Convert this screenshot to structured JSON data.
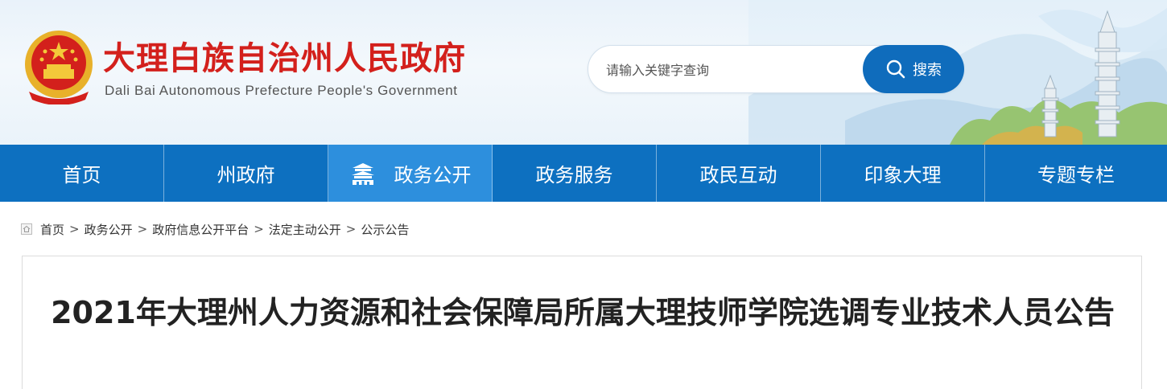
{
  "header": {
    "title": "大理白族自治州人民政府",
    "subtitle": "Dali Bai Autonomous Prefecture People's Government",
    "emblem_icon": "national-emblem-icon"
  },
  "search": {
    "placeholder": "请输入关键字查询",
    "value": "",
    "button_label": "搜索",
    "icon": "search-icon"
  },
  "nav": {
    "items": [
      {
        "label": "首页"
      },
      {
        "label": "州政府"
      },
      {
        "label": "政务公开",
        "active": true,
        "icon": "gate-icon"
      },
      {
        "label": "政务服务"
      },
      {
        "label": "政民互动"
      },
      {
        "label": "印象大理"
      },
      {
        "label": "专题专栏"
      }
    ]
  },
  "breadcrumb": {
    "items": [
      "首页",
      "政务公开",
      "政府信息公开平台",
      "法定主动公开",
      "公示公告"
    ],
    "separator": ">"
  },
  "article": {
    "title": "2021年大理州人力资源和社会保障局所属大理技师学院选调专业技术人员公告"
  },
  "colors": {
    "brand_red": "#d3201c",
    "nav_blue": "#0d70c0",
    "nav_active": "#2d8fdd",
    "search_button": "#0f6cbc"
  }
}
